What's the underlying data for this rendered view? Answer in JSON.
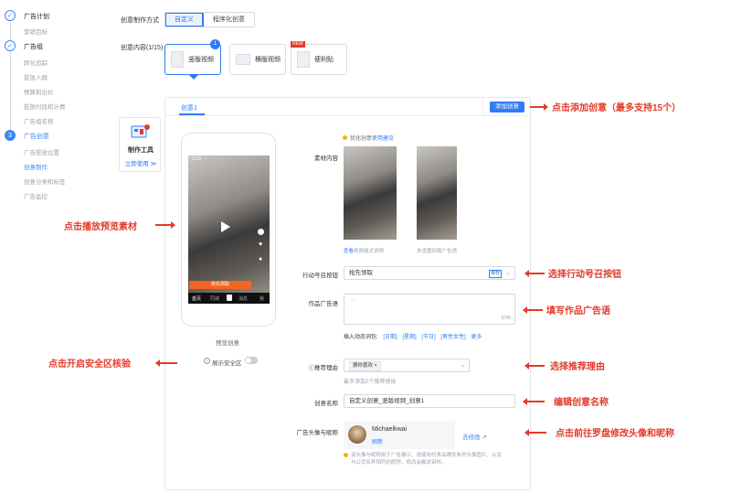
{
  "steps": [
    {
      "label": "广告计划",
      "subs": [
        "营销目标"
      ]
    },
    {
      "label": "广告组",
      "subs": [
        "转化追踪",
        "投放人群",
        "预算和出价",
        "投放时段和计费",
        "广告组名称"
      ]
    },
    {
      "label": "广告创意",
      "subs": [
        "广告投放位置",
        "创意制作",
        "创意分类和标签",
        "广告监控"
      ]
    }
  ],
  "step3_number": "3",
  "mode": {
    "label": "创意制作方式",
    "options": [
      "自定义",
      "程序化创意"
    ]
  },
  "content": {
    "label": "创意内容(1/15)",
    "types": [
      "竖版视频",
      "横版视频",
      "便利贴"
    ],
    "badge_count": "1",
    "new_badge": "NEW"
  },
  "tool_card": {
    "title": "制作工具",
    "link": "立即使用 ≫"
  },
  "panel": {
    "tab": "创意1",
    "add_button": "添加创意",
    "tip": "优化创意",
    "tip_link": "使用建议",
    "material_label": "素材内容",
    "cover1_caption_link": "查看",
    "cover1_caption": "视频格式说明",
    "cover2_caption": "未设置封面广告语",
    "preview_label": "预览创意",
    "safe_zone_label": "展示安全区",
    "cta_label": "行动号召按钮",
    "cta_value": "抢先领取",
    "cta_tag": "推荐",
    "ad_copy_label": "作品广告语",
    "ad_copy_placeholder": "···",
    "ad_copy_count": "2/30",
    "insert_label": "插入动态词包:",
    "insert_words": [
      "[日期]",
      "[星期]",
      "[节日]",
      "[男性女性]"
    ],
    "insert_more": "更多",
    "reason_label": "推荐理由",
    "reason_tag": "猜你喜欢",
    "reason_hint": "最多添加2个推荐理由",
    "name_label": "创意名称",
    "name_value": "自定义创意_竖版视频_创意1",
    "avatar_label": "广告头像与昵称",
    "avatar_name": "Michaelkwai",
    "avatar_refresh": "刷新",
    "avatar_edit": "去修改",
    "notice": "该头像与昵称用于广告展示，请使用代表品牌形象的头像图片，以及与公司名称相符的昵称，修改会触发审核。"
  },
  "phone": {
    "time": "1:19",
    "cta": "抢先领取",
    "nav": [
      "首页",
      "同城",
      "消息",
      "我"
    ]
  },
  "annotations": {
    "add": "点击添加创意（最多支持15个）",
    "play": "点击播放预览素材",
    "cta": "选择行动号召按钮",
    "copy": "填写作品广告语",
    "safe": "点击开启安全区核验",
    "reason": "选择推荐理由",
    "name": "编辑创意名称",
    "avatar": "点击前往罗盘修改头像和昵称"
  },
  "colors": {
    "accent": "#2f7cf6",
    "annotation": "#e33b2a"
  }
}
